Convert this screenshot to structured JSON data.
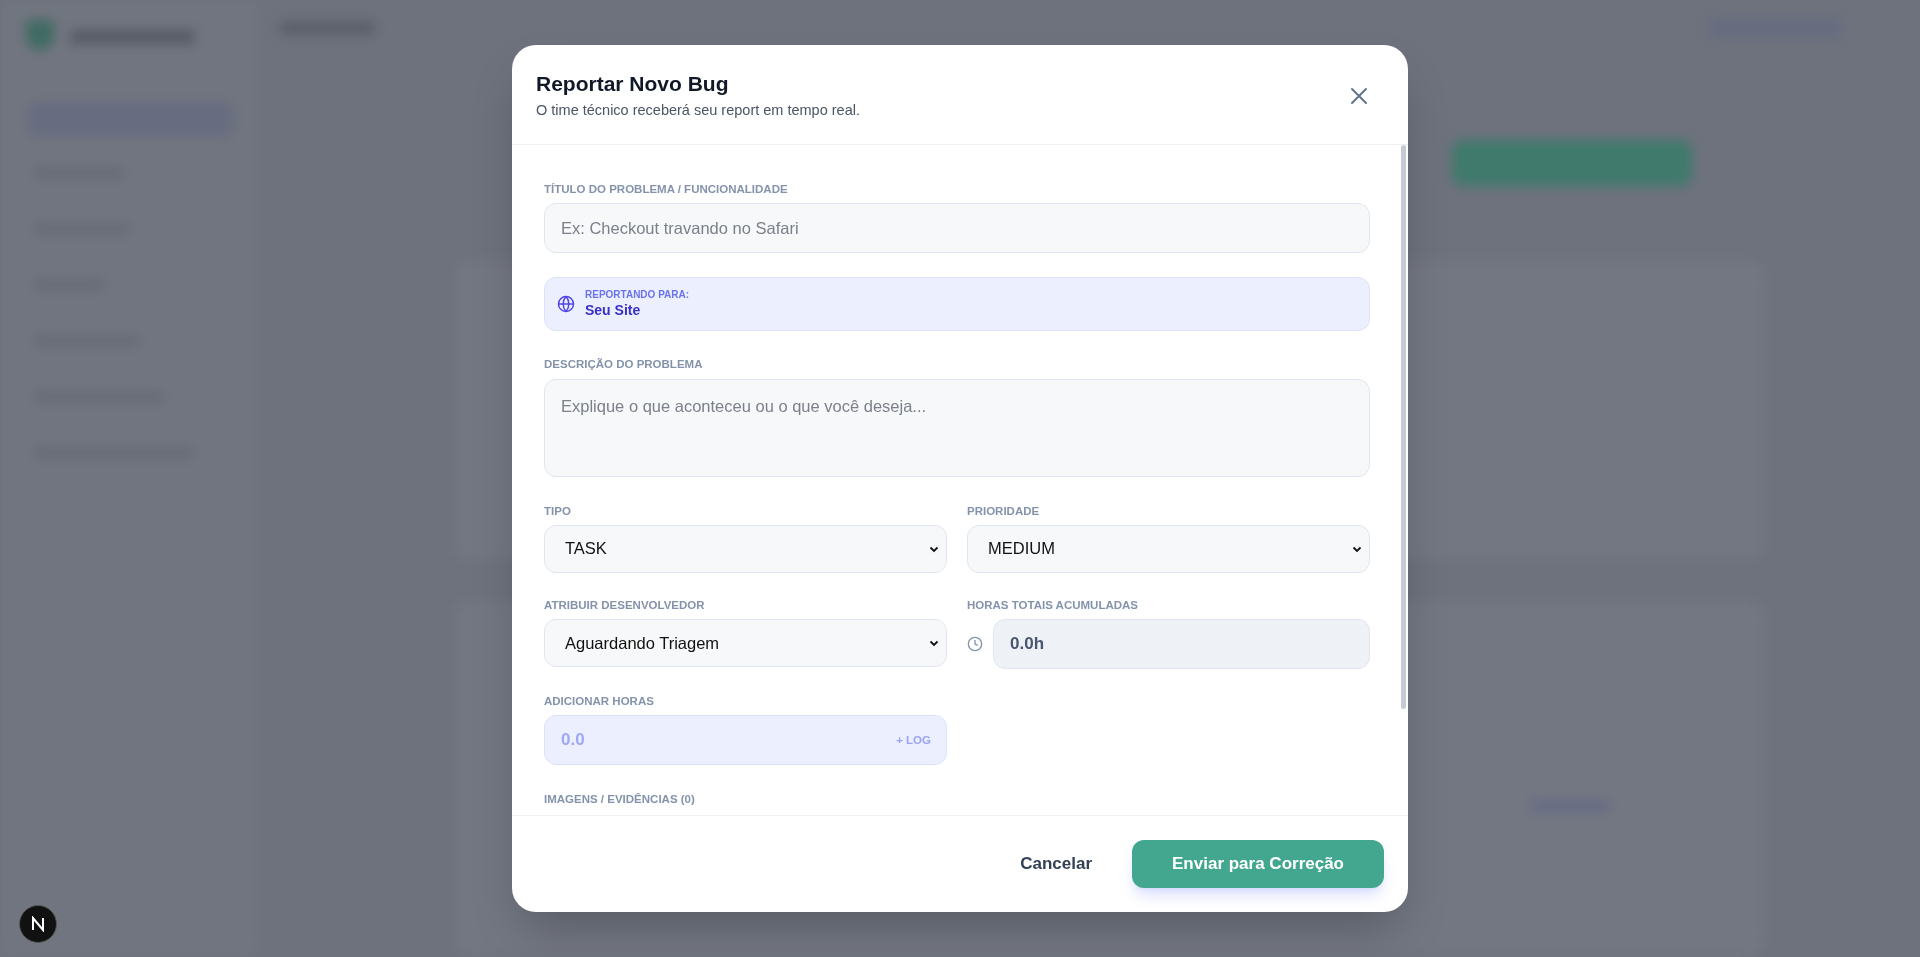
{
  "dialog": {
    "title": "Reportar Novo Bug",
    "subtitle": "O time técnico receberá seu report em tempo real."
  },
  "rows": [
    [
      {
        "kind": "text",
        "label": "TÍTULO DO PROBLEMA / FUNCIONALIDADE",
        "placeholder": "Ex: Checkout travando no Safari"
      }
    ],
    [
      {
        "kind": "target",
        "label": "REPORTANDO PARA:",
        "value": "Seu Site"
      }
    ],
    [
      {
        "kind": "textarea",
        "label": "DESCRIÇÃO DO PROBLEMA",
        "placeholder": "Explique o que aconteceu ou o que você deseja..."
      }
    ],
    [
      {
        "kind": "select",
        "label": "TIPO",
        "value": "TASK"
      },
      {
        "kind": "select",
        "label": "PRIORIDADE",
        "value": "MEDIUM"
      }
    ],
    [
      {
        "kind": "select",
        "label": "ATRIBUIR DESENVOLVEDOR",
        "value": "Aguardando Triagem"
      },
      {
        "kind": "readonly",
        "label": "HORAS TOTAIS ACUMULADAS",
        "value": "0.0h"
      }
    ],
    [
      {
        "kind": "hours",
        "label": "ADICIONAR HORAS",
        "placeholder": "0.0",
        "action": "+ LOG"
      }
    ],
    [
      {
        "kind": "upload",
        "label": "IMAGENS / EVIDÊNCIAS (0)"
      }
    ]
  ],
  "footer": {
    "cancel": "Cancelar",
    "submit": "Enviar para Correção"
  }
}
